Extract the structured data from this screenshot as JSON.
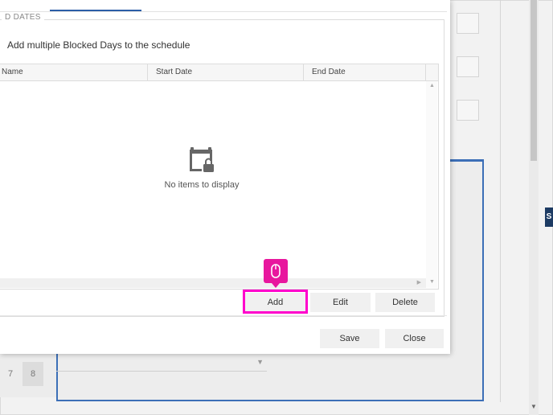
{
  "section": {
    "legend": "D DATES",
    "subtitle": "Add multiple Blocked Days to the schedule"
  },
  "grid": {
    "columns": [
      "Name",
      "Start Date",
      "End Date"
    ],
    "rows": [],
    "empty_text": "No items to display"
  },
  "grid_actions": {
    "add_label": "Add",
    "edit_label": "Edit",
    "delete_label": "Delete"
  },
  "footer": {
    "save_label": "Save",
    "close_label": "Close"
  },
  "background": {
    "days": [
      "7",
      "8"
    ],
    "side_tag": "S"
  },
  "icons": {
    "empty": "calendar-lock-icon",
    "pointer": "mouse-icon"
  },
  "colors": {
    "accent": "#2b5ea7",
    "highlight": "#ff00cc",
    "tooltip": "#e8179e",
    "side_tag": "#1d3b63"
  }
}
